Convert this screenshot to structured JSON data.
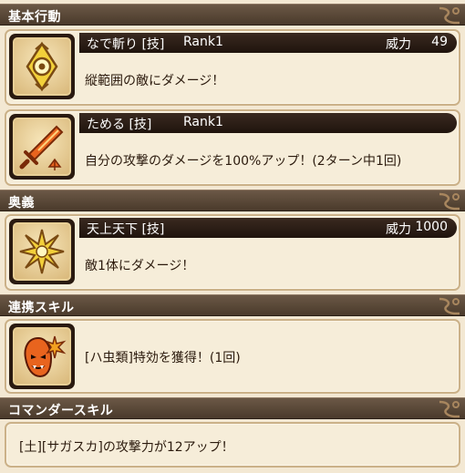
{
  "sections": {
    "basic": "基本行動",
    "ougi": "奥義",
    "link": "連携スキル",
    "commander": "コマンダースキル"
  },
  "skills": {
    "nadegiri": {
      "name": "なで斬り [技]",
      "rank": "Rank1",
      "power_label": "威力",
      "power": "49",
      "desc": "縦範囲の敵にダメージ！"
    },
    "tameru": {
      "name": "ためる [技]",
      "rank": "Rank1",
      "desc": "自分の攻撃のダメージを100%アップ！(2ターン中1回)"
    },
    "tenjou": {
      "name": "天上天下 [技]",
      "power_label": "威力",
      "power": "1000",
      "desc": "敵1体にダメージ！"
    }
  },
  "link_skill": {
    "desc": "[ハ虫類]特効を獲得！(1回)"
  },
  "commander_skill": {
    "desc": "[土][サガスカ]の攻撃力が12アップ！"
  },
  "icons": {
    "nadegiri": "vertical-slash-icon",
    "tameru": "charge-sword-icon",
    "tenjou": "burst-star-icon",
    "link": "demon-face-icon"
  },
  "colors": {
    "header_bg": "#5a4838",
    "bar_bg": "#2a1c14",
    "card_bg": "#f6edd9",
    "card_border": "#cbb188",
    "accent_orange": "#e8641e"
  }
}
